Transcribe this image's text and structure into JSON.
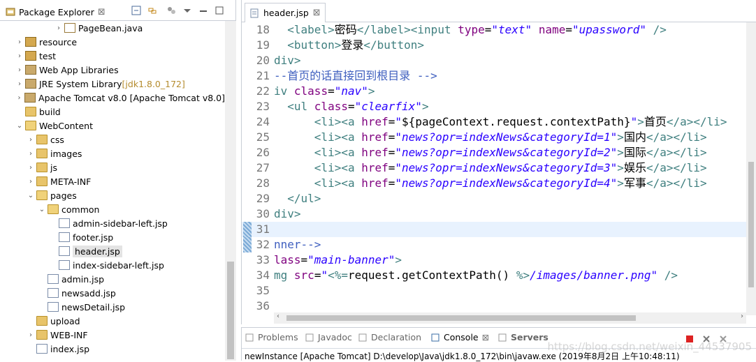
{
  "explorer": {
    "title": "Package Explorer",
    "items": [
      {
        "label": "PageBean.java",
        "suffix": "",
        "indent": 78,
        "arrow": "›",
        "icon": "java-file-icon",
        "type": "jv"
      },
      {
        "label": "resource",
        "suffix": "",
        "indent": 22,
        "arrow": "›",
        "icon": "package-folder-icon",
        "type": "pkg"
      },
      {
        "label": "test",
        "suffix": "",
        "indent": 22,
        "arrow": "›",
        "icon": "package-folder-icon",
        "type": "pkg"
      },
      {
        "label": "Web App Libraries",
        "suffix": "",
        "indent": 22,
        "arrow": "›",
        "icon": "library-icon",
        "type": "lib"
      },
      {
        "label": "JRE System Library ",
        "suffix": "[jdk1.8.0_172]",
        "indent": 22,
        "arrow": "›",
        "icon": "library-icon",
        "type": "lib"
      },
      {
        "label": "Apache Tomcat v8.0 [Apache Tomcat v8.0]",
        "suffix": "",
        "indent": 22,
        "arrow": "›",
        "icon": "library-icon",
        "type": "lib"
      },
      {
        "label": "build",
        "suffix": "",
        "indent": 22,
        "arrow": "",
        "icon": "folder-icon",
        "type": "fold"
      },
      {
        "label": "WebContent",
        "suffix": "",
        "indent": 22,
        "arrow": "⌄",
        "icon": "folder-open-icon",
        "type": "fold open"
      },
      {
        "label": "css",
        "suffix": "",
        "indent": 38,
        "arrow": "›",
        "icon": "folder-icon",
        "type": "fold"
      },
      {
        "label": "images",
        "suffix": "",
        "indent": 38,
        "arrow": "›",
        "icon": "folder-icon",
        "type": "fold"
      },
      {
        "label": "js",
        "suffix": "",
        "indent": 38,
        "arrow": "›",
        "icon": "folder-icon",
        "type": "fold"
      },
      {
        "label": "META-INF",
        "suffix": "",
        "indent": 38,
        "arrow": "›",
        "icon": "folder-icon",
        "type": "fold"
      },
      {
        "label": "pages",
        "suffix": "",
        "indent": 38,
        "arrow": "⌄",
        "icon": "folder-open-icon",
        "type": "fold open"
      },
      {
        "label": "common",
        "suffix": "",
        "indent": 54,
        "arrow": "⌄",
        "icon": "folder-open-icon",
        "type": "fold open"
      },
      {
        "label": "admin-sidebar-left.jsp",
        "suffix": "",
        "indent": 70,
        "arrow": "",
        "icon": "jsp-file-icon",
        "type": "jsp"
      },
      {
        "label": "footer.jsp",
        "suffix": "",
        "indent": 70,
        "arrow": "",
        "icon": "jsp-file-icon",
        "type": "jsp"
      },
      {
        "label": "header.jsp",
        "suffix": "",
        "indent": 70,
        "arrow": "",
        "icon": "jsp-file-icon",
        "type": "jsp",
        "selected": true
      },
      {
        "label": "index-sidebar-left.jsp",
        "suffix": "",
        "indent": 70,
        "arrow": "",
        "icon": "jsp-file-icon",
        "type": "jsp"
      },
      {
        "label": "admin.jsp",
        "suffix": "",
        "indent": 54,
        "arrow": "",
        "icon": "jsp-file-icon",
        "type": "jsp"
      },
      {
        "label": "newsadd.jsp",
        "suffix": "",
        "indent": 54,
        "arrow": "",
        "icon": "jsp-file-icon",
        "type": "jsp"
      },
      {
        "label": "newsDetail.jsp",
        "suffix": "",
        "indent": 54,
        "arrow": "",
        "icon": "jsp-file-icon",
        "type": "jsp"
      },
      {
        "label": "upload",
        "suffix": "",
        "indent": 38,
        "arrow": "",
        "icon": "folder-icon",
        "type": "fold"
      },
      {
        "label": "WEB-INF",
        "suffix": "",
        "indent": 38,
        "arrow": "›",
        "icon": "folder-icon",
        "type": "fold"
      },
      {
        "label": "index.jsp",
        "suffix": "",
        "indent": 38,
        "arrow": "",
        "icon": "jsp-file-icon",
        "type": "jsp"
      }
    ]
  },
  "editor": {
    "tab_label": "header.jsp",
    "lines": [
      {
        "n": "18",
        "html": "  <span class=\"tag\">&lt;label&gt;</span>密码<span class=\"tag\">&lt;/label&gt;&lt;input </span><span class=\"attr\">type</span>=<span class=\"val\">\"text\"</span> <span class=\"attr\">name</span>=<span class=\"val\">\"upassword\"</span> <span class=\"tag\">/&gt;</span>"
      },
      {
        "n": "19",
        "html": "  <span class=\"tag\">&lt;button&gt;</span>登录<span class=\"tag\">&lt;/button&gt;</span>"
      },
      {
        "n": "20",
        "html": "<span class=\"tag\">div&gt;</span>"
      },
      {
        "n": "21",
        "html": "<span class=\"cmt\">--首页的话直接回到根目录 --&gt;</span>"
      },
      {
        "n": "22",
        "fold": "⊖",
        "html": "<span class=\"tag\">iv </span><span class=\"attr\">class</span>=<span class=\"val\">\"nav\"</span><span class=\"tag\">&gt;</span>"
      },
      {
        "n": "23",
        "fold": "⊖",
        "html": "  <span class=\"tag\">&lt;ul </span><span class=\"attr\">class</span>=<span class=\"val\">\"clearfix\"</span><span class=\"tag\">&gt;</span>"
      },
      {
        "n": "24",
        "html": "      <span class=\"tag\">&lt;li&gt;&lt;a </span><span class=\"attr\">href</span>=<span class=\"val\">\"</span>${pageContext.request.contextPath}<span class=\"val\">\"</span><span class=\"tag\">&gt;</span>首页<span class=\"tag\">&lt;/a&gt;&lt;/li&gt;</span>"
      },
      {
        "n": "25",
        "html": "      <span class=\"tag\">&lt;li&gt;&lt;a </span><span class=\"attr\">href</span>=<span class=\"val\">\"news?opr=indexNews&amp;categoryId=1\"</span><span class=\"tag\">&gt;</span>国内<span class=\"tag\">&lt;/a&gt;&lt;/li&gt;</span>"
      },
      {
        "n": "26",
        "html": "      <span class=\"tag\">&lt;li&gt;&lt;a </span><span class=\"attr\">href</span>=<span class=\"val\">\"news?opr=indexNews&amp;categoryId=2\"</span><span class=\"tag\">&gt;</span>国际<span class=\"tag\">&lt;/a&gt;&lt;/li&gt;</span>"
      },
      {
        "n": "27",
        "html": "      <span class=\"tag\">&lt;li&gt;&lt;a </span><span class=\"attr\">href</span>=<span class=\"val\">\"news?opr=indexNews&amp;categoryId=3\"</span><span class=\"tag\">&gt;</span>娱乐<span class=\"tag\">&lt;/a&gt;&lt;/li&gt;</span>"
      },
      {
        "n": "28",
        "html": "      <span class=\"tag\">&lt;li&gt;&lt;a </span><span class=\"attr\">href</span>=<span class=\"val\">\"news?opr=indexNews&amp;categoryId=4\"</span><span class=\"tag\">&gt;</span>军事<span class=\"tag\">&lt;/a&gt;&lt;/li&gt;</span>"
      },
      {
        "n": "29",
        "html": "  <span class=\"tag\">&lt;/ul&gt;</span>"
      },
      {
        "n": "30",
        "html": "<span class=\"tag\">div&gt;</span>"
      },
      {
        "n": "31",
        "html": "",
        "highlight": true,
        "marker": true
      },
      {
        "n": "32",
        "html": "<span class=\"cmt\">nner--&gt;</span>",
        "marker": true
      },
      {
        "n": "33",
        "fold": "⊖",
        "html": "<span class=\"attr\">lass</span>=<span class=\"val\">\"main-banner\"</span><span class=\"tag\">&gt;</span>"
      },
      {
        "n": "34",
        "html": "<span class=\"tag\">mg </span><span class=\"attr\">src</span>=<span class=\"val\">\"</span><span class=\"tag\">&lt;%=</span>request.getContextPath() <span class=\"tag\">%&gt;</span><span class=\"val\">/images/banner.png\"</span> <span class=\"tag\">/&gt;</span>"
      },
      {
        "n": "35",
        "html": ""
      },
      {
        "n": "36",
        "html": ""
      }
    ]
  },
  "console": {
    "tabs": [
      {
        "label": "Problems",
        "icon": "problems-icon",
        "active": false
      },
      {
        "label": "Javadoc",
        "icon": "at-icon",
        "active": false
      },
      {
        "label": "Declaration",
        "icon": "declaration-icon",
        "active": false
      },
      {
        "label": "Console",
        "icon": "console-icon",
        "active": true
      },
      {
        "label": "Servers",
        "icon": "servers-icon",
        "active": false
      }
    ],
    "status_line": "newInstance [Apache Tomcat] D:\\develop\\Java\\jdk1.8.0_172\\bin\\javaw.exe (2019年8月2日 上午10:48:11)",
    "watermark": "https://blog.csdn.net/weixin_44537905"
  }
}
